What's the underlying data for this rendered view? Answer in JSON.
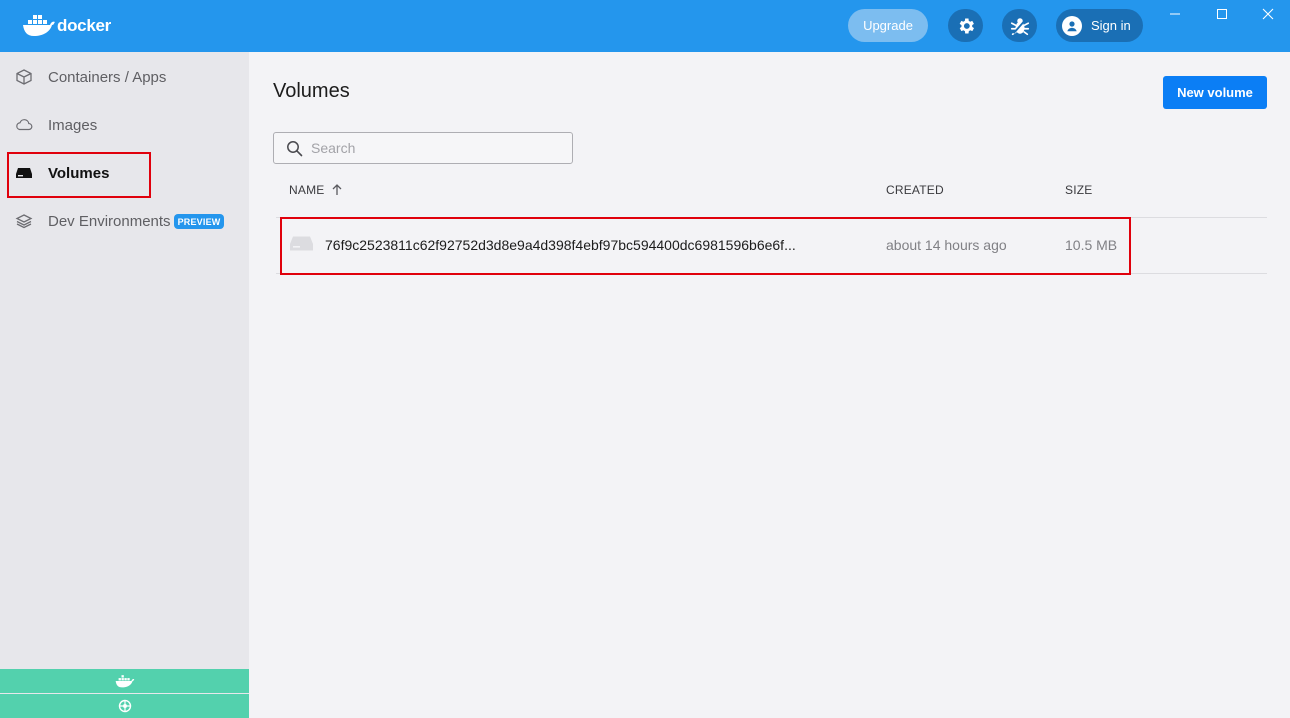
{
  "app": {
    "logo_text": "docker"
  },
  "topbar": {
    "upgrade_label": "Upgrade",
    "signin_label": "Sign in"
  },
  "sidebar": {
    "items": [
      {
        "label": "Containers / Apps",
        "icon": "container-icon"
      },
      {
        "label": "Images",
        "icon": "cloud-icon"
      },
      {
        "label": "Volumes",
        "icon": "volume-icon",
        "active": true
      },
      {
        "label": "Dev Environments",
        "icon": "layers-icon",
        "badge": "PREVIEW"
      }
    ]
  },
  "main": {
    "title": "Volumes",
    "new_button": "New volume",
    "search_placeholder": "Search",
    "columns": {
      "name": "NAME",
      "created": "CREATED",
      "size": "SIZE"
    },
    "rows": [
      {
        "name": "76f9c2523811c62f92752d3d8e9a4d398f4ebf97bc594400dc6981596b6e6f...",
        "created": "about 14 hours ago",
        "size": "10.5 MB"
      }
    ]
  },
  "colors": {
    "brand": "#2496ed",
    "primary_button": "#0b7ef5",
    "status_bar": "#53d1ad",
    "highlight": "#e0000c"
  }
}
